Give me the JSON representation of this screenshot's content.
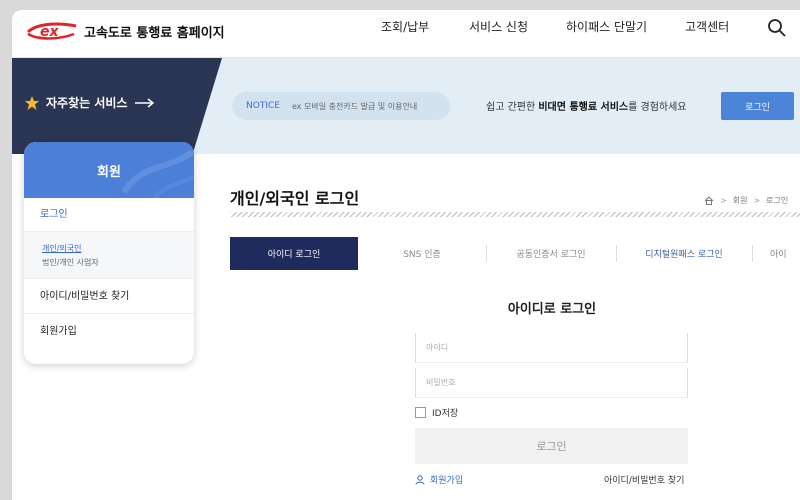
{
  "header": {
    "site_title": "고속도로 통행료 홈페이지",
    "logo_mark": "ex",
    "nav": [
      "조회/납부",
      "서비스 신청",
      "하이패스 단말기",
      "고객센터"
    ],
    "search_icon": "search-icon"
  },
  "banner": {
    "favorites_label": "자주찾는 서비스",
    "notice_tag": "NOTICE",
    "notice_text": "ex 모바일 충전카드 발급 및 이용안내",
    "promo_prefix": "쉽고 간편한 ",
    "promo_bold": "비대면 통행료 서비스",
    "promo_suffix": "를 경험하세요",
    "login_button": "로그인"
  },
  "sidebar": {
    "title": "회원",
    "login": "로그인",
    "sub_items": [
      "개인/외국인",
      "법인/개인 사업자"
    ],
    "find": "아이디/비밀번호 찾기",
    "signup": "회원가입"
  },
  "main": {
    "page_title": "개인/외국인 로그인",
    "breadcrumb": [
      "회원",
      "로그인"
    ],
    "tabs": [
      "아이디 로그인",
      "SNS 인증",
      "공동인증서 로그인",
      "디지털원패스 로그인",
      "아이"
    ],
    "form_title": "아이디로 로그인",
    "id_placeholder": "아이디",
    "pw_placeholder": "비밀번호",
    "id_save": "ID저장",
    "login_button": "로그인",
    "signup_link": "회원가입",
    "find_link": "아이디/비밀번호 찾기"
  },
  "colors": {
    "brand_red": "#e1242b",
    "banner_dark": "#2b3554",
    "accent_blue": "#4c80d8",
    "active_tab": "#1f2b5c"
  }
}
